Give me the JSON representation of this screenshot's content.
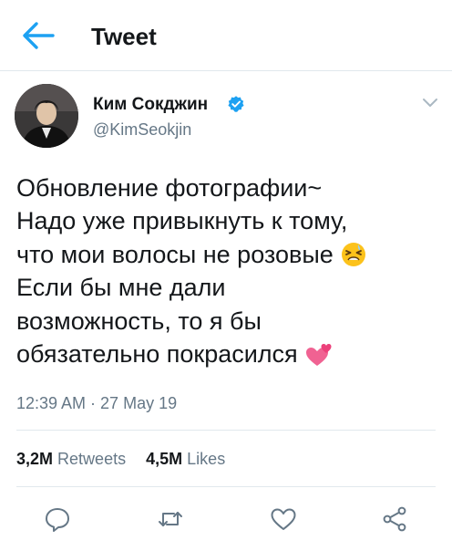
{
  "topbar": {
    "title": "Tweet",
    "back_icon": "arrow-left-icon"
  },
  "author": {
    "display_name": "Ким Сокджин",
    "handle": "@KimSeokjin",
    "verified": true
  },
  "tweet": {
    "lines": [
      "Обновление фотографии~",
      "Надо уже привыкнуть к тому,",
      "что мои волосы не розовые",
      "Если бы мне дали",
      "возможность, то я бы",
      "обязательно покрасился"
    ],
    "emoji": [
      "tired-face-emoji",
      "two-hearts-emoji"
    ]
  },
  "timestamp": "12:39 AM · 27 May 19",
  "stats": {
    "retweets_count": "3,2M",
    "retweets_label": "Retweets",
    "likes_count": "4,5M",
    "likes_label": "Likes"
  },
  "actions": [
    "reply-icon",
    "retweet-icon",
    "like-icon",
    "share-icon"
  ],
  "colors": {
    "accent": "#1da1f2",
    "text": "#14171a",
    "muted": "#657786",
    "border": "#e1e8ed"
  }
}
